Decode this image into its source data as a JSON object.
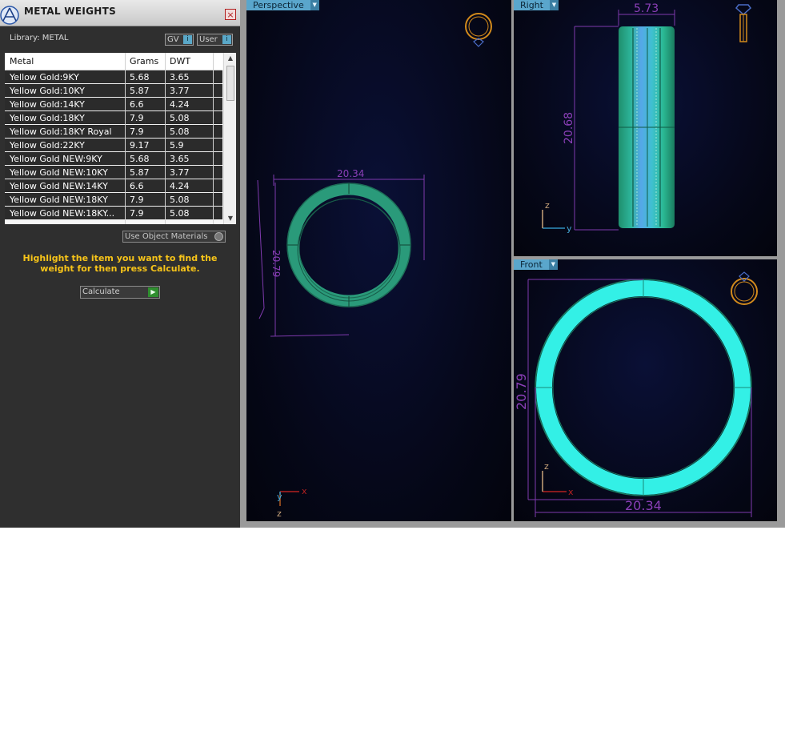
{
  "panel": {
    "title": "METAL WEIGHTS",
    "close_icon": "×",
    "library_label": "Library: METAL",
    "gv_label": "GV",
    "user_label": "User",
    "columns": [
      "Metal",
      "Grams",
      "DWT"
    ],
    "rows": [
      {
        "metal": "Yellow Gold:9KY",
        "grams": "5.68",
        "dwt": "3.65"
      },
      {
        "metal": "Yellow Gold:10KY",
        "grams": "5.87",
        "dwt": "3.77"
      },
      {
        "metal": "Yellow Gold:14KY",
        "grams": "6.6",
        "dwt": "4.24"
      },
      {
        "metal": "Yellow Gold:18KY",
        "grams": "7.9",
        "dwt": "5.08"
      },
      {
        "metal": "Yellow Gold:18KY Royal",
        "grams": "7.9",
        "dwt": "5.08"
      },
      {
        "metal": "Yellow Gold:22KY",
        "grams": "9.17",
        "dwt": "5.9"
      },
      {
        "metal": "Yellow Gold NEW:9KY",
        "grams": "5.68",
        "dwt": "3.65"
      },
      {
        "metal": "Yellow Gold NEW:10KY",
        "grams": "5.87",
        "dwt": "3.77"
      },
      {
        "metal": "Yellow Gold NEW:14KY",
        "grams": "6.6",
        "dwt": "4.24"
      },
      {
        "metal": "Yellow Gold NEW:18KY",
        "grams": "7.9",
        "dwt": "5.08"
      },
      {
        "metal": "Yellow Gold NEW:18KY...",
        "grams": "7.9",
        "dwt": "5.08"
      }
    ],
    "use_object_materials": "Use Object Materials",
    "instructions": "Highlight the item you want to find the weight for then press Calculate.",
    "calculate_label": "Calculate"
  },
  "viewports": {
    "perspective": {
      "label": "Perspective",
      "dim_width": "20.34",
      "dim_height": "20.79",
      "axis_y": "y",
      "axis_x": "x",
      "axis_z": "z"
    },
    "right": {
      "label": "Right",
      "dim_width": "5.73",
      "dim_height": "20.68",
      "axis_z": "z",
      "axis_y": "y"
    },
    "front": {
      "label": "Front",
      "dim_height": "20.79",
      "dim_width": "20.34",
      "axis_z": "z",
      "axis_x": "x"
    }
  },
  "colors": {
    "ring_green": "#2aa883",
    "ring_cyan": "#33f0e6",
    "dimension_purple": "#8b3fb8",
    "accent_gold": "#f7c419",
    "viewport_tab": "#5aa6cc"
  }
}
